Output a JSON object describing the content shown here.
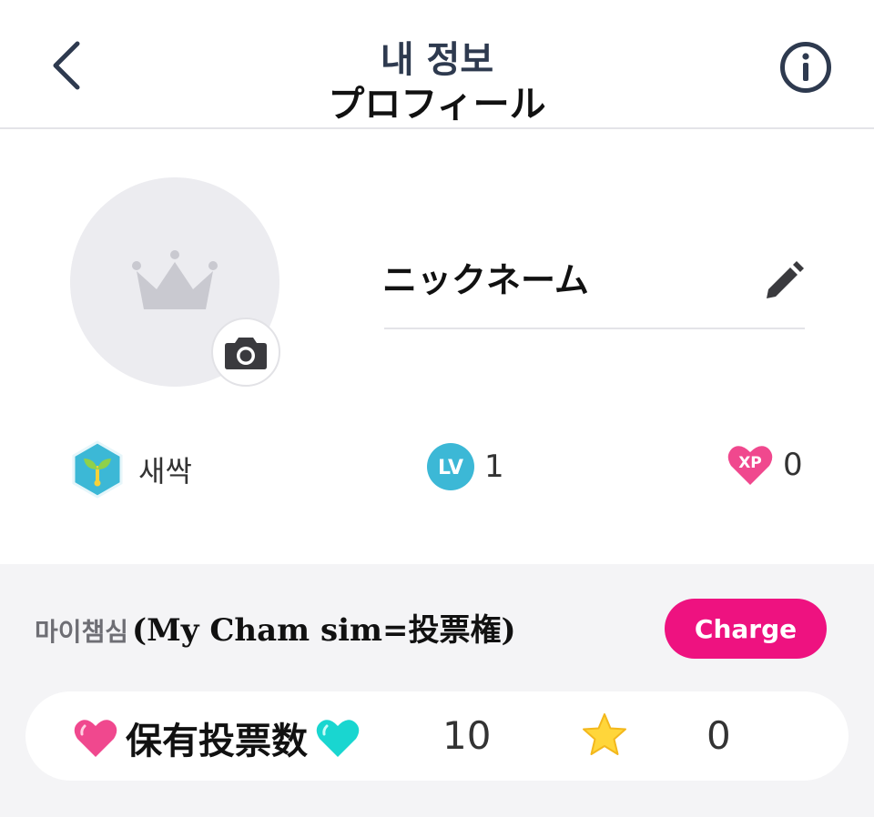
{
  "header": {
    "title_ko": "내 정보",
    "title_ja": "プロフィール",
    "back_icon": "chevron-left-icon",
    "info_icon": "info-circle-icon"
  },
  "profile": {
    "avatar_icon": "crown-icon",
    "camera_icon": "camera-icon",
    "nickname": "ニックネーム",
    "edit_icon": "pencil-icon"
  },
  "stats": {
    "grade_label": "새싹",
    "grade_icon": "sprout-hexagon-icon",
    "level_badge": "LV",
    "level_value": "1",
    "xp_badge": "XP",
    "xp_value": "0"
  },
  "mycham": {
    "label_ko": "마이챔심",
    "label_en": "(My Cham sim=投票権)",
    "charge_label": "Charge"
  },
  "votes": {
    "label": "保有投票数",
    "count": "10",
    "star_count": "0",
    "star_icon": "star-icon"
  },
  "colors": {
    "accent_pink": "#ee1280",
    "level_blue": "#3cb8d6",
    "heart_pink": "#f0488e",
    "heart_teal": "#19d6d0",
    "star_yellow": "#ffd63a"
  }
}
